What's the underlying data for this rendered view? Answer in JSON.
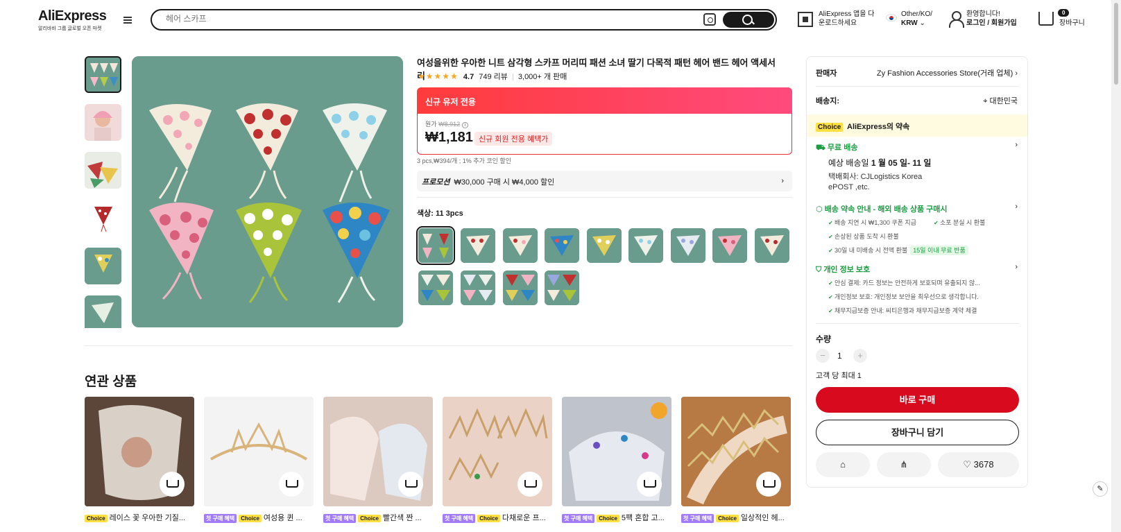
{
  "header": {
    "logo": "AliExpress",
    "logo_sub": "알리바바 그룹 글로벌 오픈 마켓",
    "search_placeholder": "헤어 스카프",
    "app_line1": "AliExpress 앱을 다",
    "app_line2": "운로드하세요",
    "region_line1": "Other/KO/",
    "region_line2": "KRW",
    "user_line1": "환영합니다!",
    "user_line2": "로그인 / 회원가입",
    "cart_count": "0",
    "cart_label": "장바구니"
  },
  "product": {
    "title": "여성을위한 우아한 니트 삼각형 스카프 머리띠 패션 소녀 딸기 다목적 패턴 헤어 밴드 헤어 액세서리",
    "rating": "4.7",
    "reviews": "749 리뷰",
    "sold": "3,000+ 개 판매",
    "new_user_banner": "신규 유저 전용",
    "orig_label": "원가",
    "orig_price": "₩8,912",
    "price": "₩1,181",
    "price_badge": "신규 회원 전용 혜택가",
    "sub_info": "3 pcs,₩394/개 ; 1% 추가 코인 할인",
    "promo_label": "프로모션",
    "promo_text": "₩30,000 구매 시 ₩4,000 할인",
    "color_label": "색상: 11 3pcs"
  },
  "related": {
    "heading": "연관 상품",
    "items": [
      {
        "first": "",
        "title": "레이스 꽃 우아한 기질..."
      },
      {
        "first": "첫 구매 혜택",
        "title": "여성용 퀸 ..."
      },
      {
        "first": "첫 구매 혜택",
        "title": "빨간색 짠 ..."
      },
      {
        "first": "첫 구매 혜택",
        "title": "다채로운 프..."
      },
      {
        "first": "첫 구매 혜택",
        "title": "5팩 혼합 고..."
      },
      {
        "first": "첫 구매 혜택",
        "title": "일상적인 헤..."
      }
    ],
    "choice_tag": "Choice"
  },
  "panel": {
    "seller_label": "판매자",
    "seller_name": "Zy Fashion Accessories Store(거래 업체)",
    "ship_label": "배송지:",
    "ship_dest": "대한민국",
    "choice_tag": "Choice",
    "choice_text": "AliExpress의 약속",
    "free_ship": "무료 배송",
    "est_label": "예상 배송일",
    "est_dates": "1 월 05 일- 11 일",
    "carrier_line1": "택배회사:    CJLogistics    Korea",
    "carrier_line2": "ePOST ,etc.",
    "promise": "배송 약속 안내 - 해외 배송 상품 구매시",
    "p1": "배송 지연 시 ₩1,300 쿠폰 지급",
    "p2": "소포 분실 시 환불",
    "p3": "손상된 상품 도착 시 환불",
    "p4": "30일 내 미배송 시 전액 환불",
    "p4_tag": "15일 이내 무료 반품",
    "privacy": "개인 정보 보호",
    "s1": "안심 결제: 카드 정보는 안전하게 보호되며 유출되지 않...",
    "s2": "개인정보 보호: 개인정보 보안을 최우선으로 생각합니다.",
    "s3": "채무지급보증 안내: 씨티은행과 채무지급보증 계약 체결",
    "qty_label": "수량",
    "qty_minus": "−",
    "qty_plus": "+",
    "qty": "1",
    "limit": "고객 당 최대 1",
    "buy_now": "바로 구매",
    "add_cart": "장바구니 담기",
    "wish_count": "3678"
  },
  "colors": {
    "accent_red": "#d70a1e",
    "green": "#1a9e41",
    "product_bg": "#6a9c8e"
  }
}
